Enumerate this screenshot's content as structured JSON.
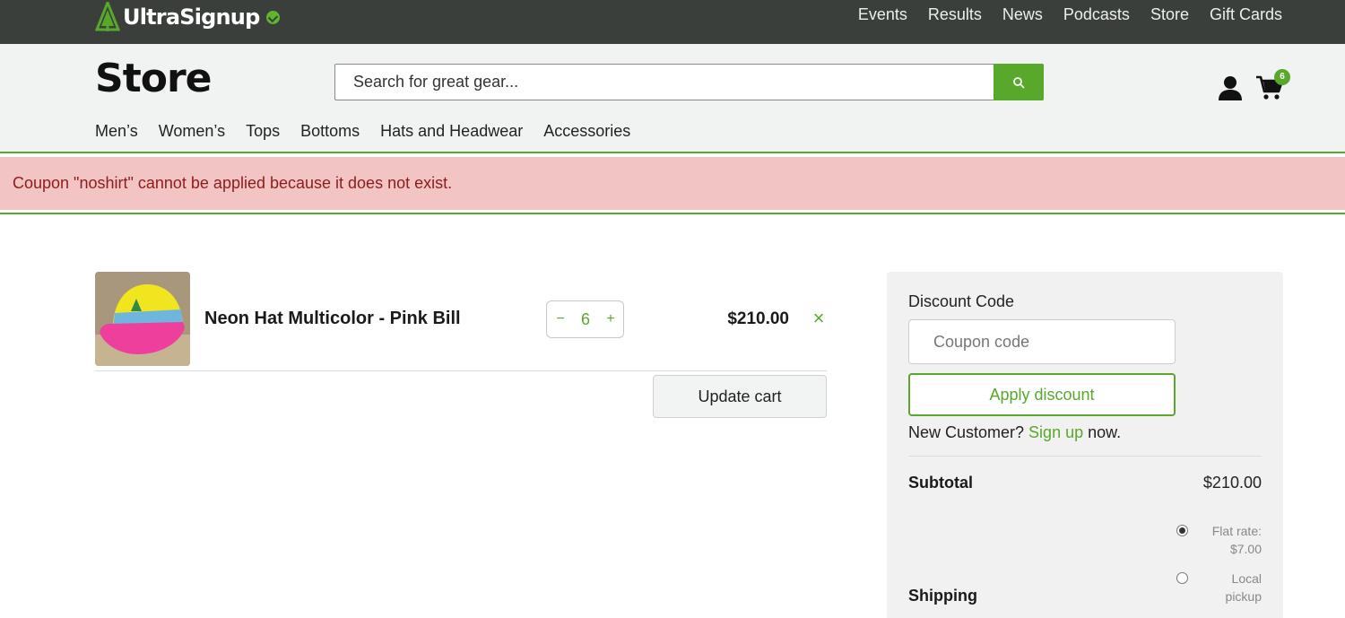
{
  "header": {
    "logo_text": "UltraSignup",
    "nav": [
      "Events",
      "Results",
      "News",
      "Podcasts",
      "Store",
      "Gift Cards"
    ]
  },
  "store": {
    "title": "Store",
    "search_placeholder": "Search for great gear...",
    "cart_count": "6",
    "categories": [
      "Men’s",
      "Women’s",
      "Tops",
      "Bottoms",
      "Hats and Headwear",
      "Accessories"
    ]
  },
  "notice": {
    "error": "Coupon \"noshirt\" cannot be applied because it does not exist."
  },
  "cart": {
    "item": {
      "name": "Neon Hat Multicolor - Pink Bill",
      "quantity": "6",
      "price": "$210.00",
      "minus": "−",
      "plus": "+",
      "remove": "×"
    },
    "update_label": "Update cart"
  },
  "summary": {
    "discount_label": "Discount Code",
    "coupon_placeholder": "Coupon code",
    "apply_label": "Apply discount",
    "new_customer_prefix": "New Customer? ",
    "signup_link": "Sign up",
    "new_customer_suffix": " now.",
    "subtotal_label": "Subtotal",
    "subtotal_value": "$210.00",
    "shipping_options": [
      {
        "line1": "Flat rate:",
        "line2": "$7.00",
        "selected": true
      },
      {
        "line1": "Local",
        "line2": "pickup",
        "selected": false
      }
    ],
    "shipping_label": "Shipping"
  },
  "colors": {
    "accent": "#57a82b",
    "topbar": "#3a3f3c",
    "error_bg": "#f2c4c4",
    "error_text": "#8b1d1d"
  },
  "icons": [
    "logo-tree-icon",
    "verified-check-icon",
    "search-icon",
    "user-icon",
    "cart-icon",
    "close-icon"
  ]
}
